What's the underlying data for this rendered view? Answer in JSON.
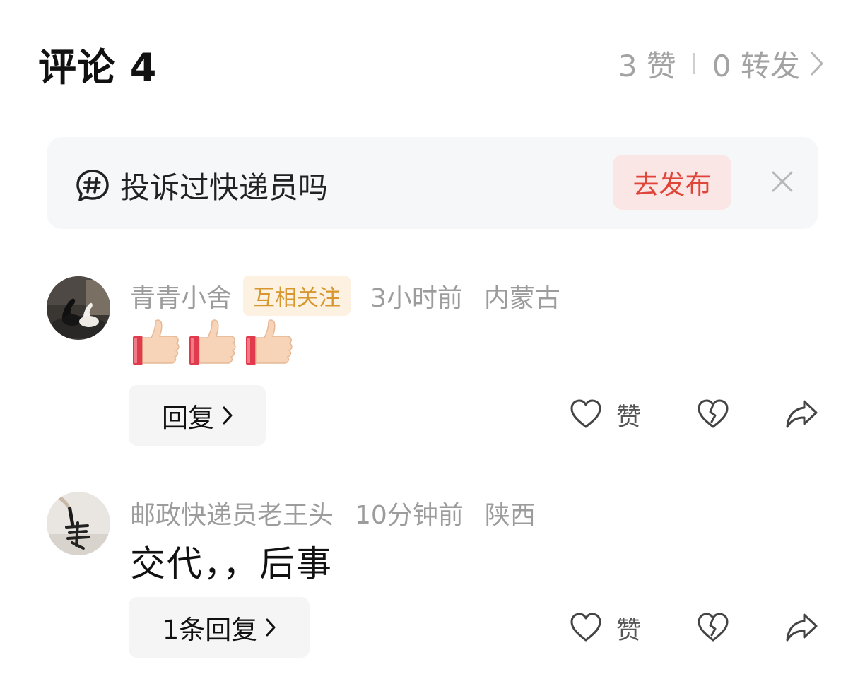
{
  "header": {
    "title": "评论 4",
    "likes": "3 赞",
    "reposts": "0 转发"
  },
  "topic": {
    "text": "投诉过快递员吗",
    "publish_label": "去发布",
    "icon": "hashtag-bubble-icon",
    "accent_color": "#e0453a"
  },
  "comments": [
    {
      "username": "青青小舍",
      "badge": "互相关注",
      "time": "3小时前",
      "location": "内蒙古",
      "content_emoji": [
        "👍",
        "👍",
        "👍"
      ],
      "reply_label": "回复",
      "like_label": "赞"
    },
    {
      "username": "邮政快递员老王头",
      "time": "10分钟前",
      "location": "陕西",
      "content": "交代，，后事",
      "reply_label": "1条回复",
      "like_label": "赞"
    }
  ]
}
